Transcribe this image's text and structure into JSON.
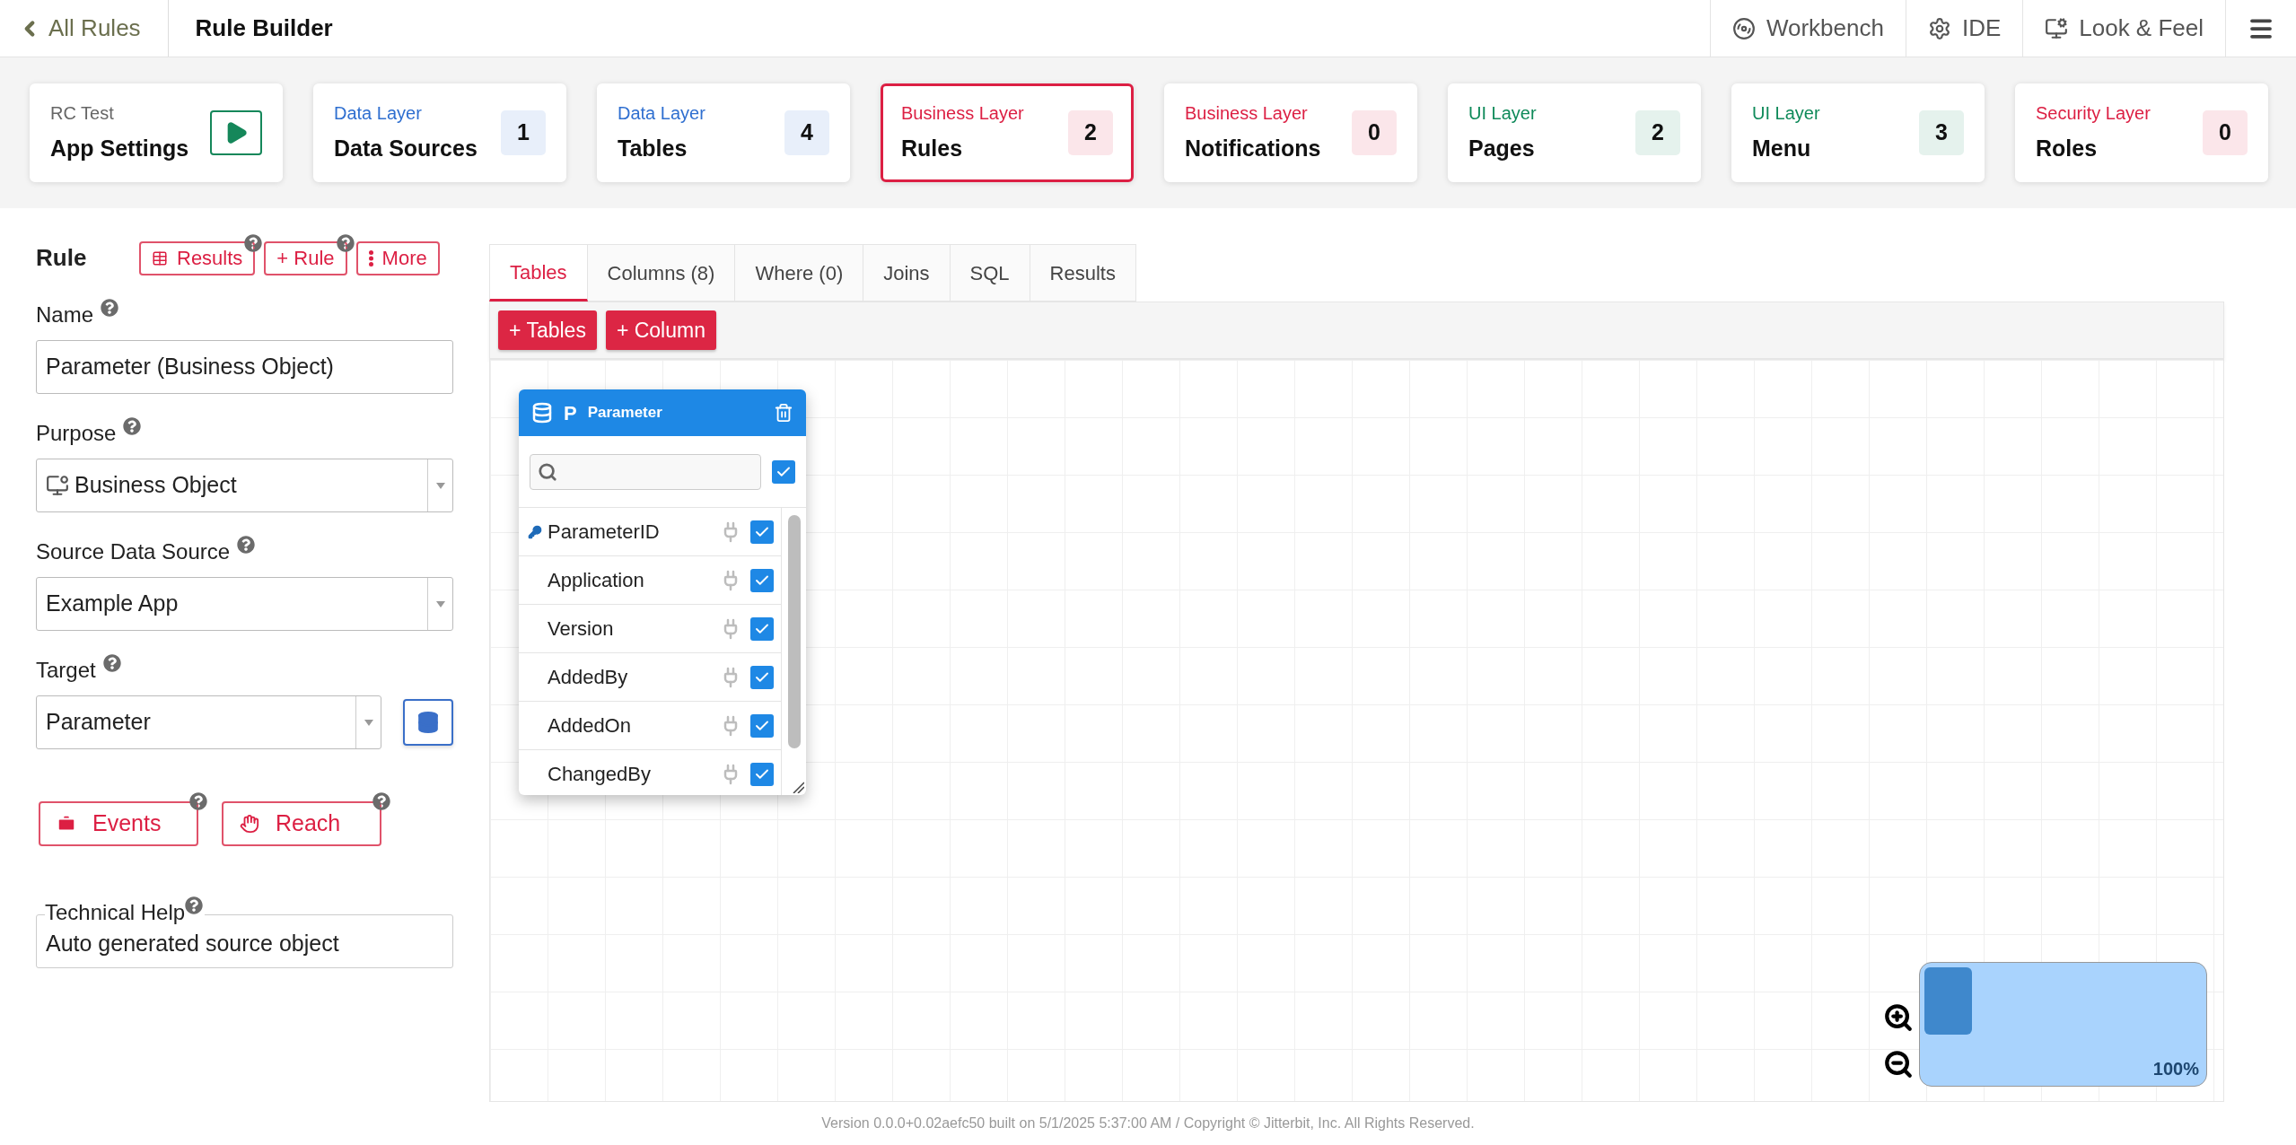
{
  "header": {
    "back_link": "All Rules",
    "title": "Rule Builder",
    "nav": [
      "Workbench",
      "IDE",
      "Look & Feel"
    ]
  },
  "cards": [
    {
      "kind": "app",
      "layer": "RC Test",
      "title": "App Settings",
      "selected": false
    },
    {
      "kind": "layer",
      "layer": "Data Layer",
      "title": "Data Sources",
      "count": "1",
      "color": "#2f6fd0",
      "selected": false
    },
    {
      "kind": "layer",
      "layer": "Data Layer",
      "title": "Tables",
      "count": "4",
      "color": "#2f6fd0",
      "selected": false
    },
    {
      "kind": "layer",
      "layer": "Business Layer",
      "title": "Rules",
      "count": "2",
      "color": "#dc1f43",
      "selected": true
    },
    {
      "kind": "layer",
      "layer": "Business Layer",
      "title": "Notifications",
      "count": "0",
      "color": "#dc1f43",
      "selected": false
    },
    {
      "kind": "layer",
      "layer": "UI Layer",
      "title": "Pages",
      "count": "2",
      "color": "#0f8a5a",
      "selected": false
    },
    {
      "kind": "layer",
      "layer": "UI Layer",
      "title": "Menu",
      "count": "3",
      "color": "#0f8a5a",
      "selected": false
    },
    {
      "kind": "layer",
      "layer": "Security Layer",
      "title": "Roles",
      "count": "0",
      "color": "#dc1f43",
      "selected": false
    }
  ],
  "rule_panel": {
    "title": "Rule",
    "buttons": [
      {
        "label": "Results",
        "help": true
      },
      {
        "label": "+ Rule",
        "help": true
      },
      {
        "label": "More",
        "help": false
      }
    ],
    "fields": [
      {
        "kind": "text",
        "label": "Name",
        "value": "Parameter (Business Object)"
      },
      {
        "kind": "select",
        "label": "Purpose",
        "value": "Business Object",
        "icon": true
      },
      {
        "kind": "select",
        "label": "Source Data Source",
        "value": "Example App"
      },
      {
        "kind": "select",
        "label": "Target",
        "value": "Parameter",
        "db_button": true
      }
    ],
    "actions": [
      "Events",
      "Reach"
    ],
    "technical_help": {
      "label": "Technical Help",
      "value": "Auto generated source object"
    }
  },
  "tabs": [
    {
      "label": "Tables",
      "selected": true
    },
    {
      "label": "Columns (8)",
      "selected": false
    },
    {
      "label": "Where (0)",
      "selected": false
    },
    {
      "label": "Joins",
      "selected": false
    },
    {
      "label": "SQL",
      "selected": false
    },
    {
      "label": "Results",
      "selected": false
    }
  ],
  "toolbar": [
    "+ Tables",
    "+ Column"
  ],
  "table_widget": {
    "badge": "P",
    "name": "Parameter",
    "select_all": true,
    "columns": [
      {
        "name": "ParameterID",
        "key": true,
        "checked": true
      },
      {
        "name": "Application",
        "key": false,
        "checked": true
      },
      {
        "name": "Version",
        "key": false,
        "checked": true
      },
      {
        "name": "AddedBy",
        "key": false,
        "checked": true
      },
      {
        "name": "AddedOn",
        "key": false,
        "checked": true
      },
      {
        "name": "ChangedBy",
        "key": false,
        "checked": true
      }
    ]
  },
  "minimap": {
    "zoom": "100%"
  },
  "footer": "Version 0.0.0+0.02aefc50 built on 5/1/2025 5:37:00 AM / Copyright © Jitterbit, Inc. All Rights Reserved."
}
